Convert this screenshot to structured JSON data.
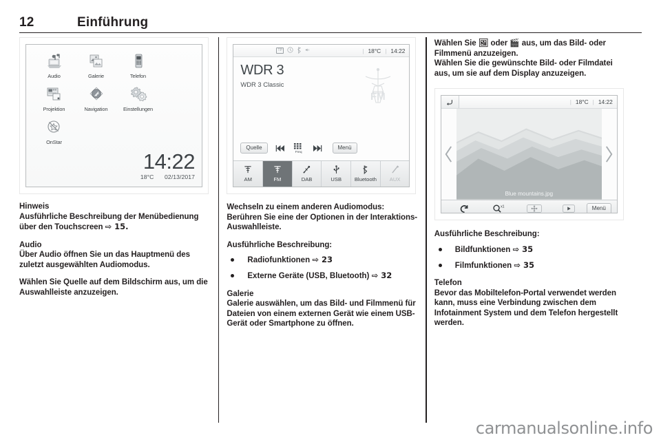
{
  "header": {
    "page_number": "12",
    "chapter": "Einführung"
  },
  "watermark": "carmanualsonline.info",
  "colors": {
    "text": "#231f20",
    "screen_border": "#b9bcbe",
    "active_tab": "#6f7477",
    "disabled_text": "#b4b8bb"
  },
  "screen_home": {
    "tiles": [
      {
        "label": "Audio",
        "icon": "audio-speaker-icon"
      },
      {
        "label": "Galerie",
        "icon": "gallery-pictures-icon"
      },
      {
        "label": "Telefon",
        "icon": "smartphone-icon"
      },
      {
        "label": "Projektion",
        "icon": "projection-screen-icon"
      },
      {
        "label": "Navigation",
        "icon": "navigation-compass-icon"
      },
      {
        "label": "Einstellungen",
        "icon": "settings-gears-icon"
      },
      {
        "label": "OnStar",
        "icon": "onstar-crossed-icon"
      }
    ],
    "clock": "14:22",
    "temperature": "18°C",
    "date": "02/13/2017"
  },
  "screen_radio": {
    "status_icons": [
      "tp-badge",
      "clock-icon",
      "bluetooth-icon",
      "mute-speaker-icon"
    ],
    "tp_label": "TP",
    "temperature": "18°C",
    "clock": "14:22",
    "station_name": "WDR 3",
    "station_info": "WDR 3 Classic",
    "logo_label": "FM",
    "controls": [
      {
        "label": "Quelle",
        "type": "pill",
        "icon": ""
      },
      {
        "label": "",
        "type": "icon",
        "icon": "skip-previous-icon"
      },
      {
        "label": "Freq",
        "type": "icon",
        "icon": "frequency-keypad-icon"
      },
      {
        "label": "",
        "type": "icon",
        "icon": "skip-next-icon"
      },
      {
        "label": "Menü",
        "type": "pill",
        "icon": ""
      }
    ],
    "sources": [
      {
        "label": "AM",
        "icon": "antenna-icon",
        "state": "normal"
      },
      {
        "label": "FM",
        "icon": "antenna-icon",
        "state": "active"
      },
      {
        "label": "DAB",
        "icon": "dab-antenna-icon",
        "state": "normal"
      },
      {
        "label": "USB",
        "icon": "usb-icon",
        "state": "normal"
      },
      {
        "label": "Bluetooth",
        "icon": "bluetooth-icon",
        "state": "normal"
      },
      {
        "label": "AUX",
        "icon": "aux-jack-icon",
        "state": "disabled"
      }
    ]
  },
  "screen_gallery": {
    "back_icon": "back-arrow-icon",
    "temperature": "18°C",
    "clock": "14:22",
    "file_name": "Blue mountains.jpg",
    "prev_icon": "chevron-left-icon",
    "next_icon": "chevron-right-icon",
    "tools": [
      {
        "icon": "rotate-icon",
        "label": ""
      },
      {
        "icon": "zoom-icon",
        "label": "x1"
      },
      {
        "icon": "pan-move-icon",
        "label": ""
      },
      {
        "icon": "slideshow-play-icon",
        "label": ""
      },
      {
        "icon": "",
        "label": "Menü"
      }
    ]
  },
  "col1": {
    "note_heading": "Hinweis",
    "note_text": "Ausführliche Beschreibung der Menübedienung über den Touchscreen ",
    "note_ref": "⇨ 15.",
    "audio_heading": "Audio",
    "audio_p1": "Über Audio öffnen Sie un das Hauptmenü des zuletzt ausgewählten Audiomodus.",
    "audio_p2": "Wählen Sie Quelle auf dem Bildschirm aus, um die Auswahlleiste anzuzeigen."
  },
  "col2": {
    "p1": "Wechseln zu einem anderen Audiomodus: Berühren Sie eine der Optionen in der Interaktions-Auswahlleiste.",
    "detail_heading": "Ausführliche Beschreibung:",
    "bullets": [
      {
        "text": "Radiofunktionen ",
        "ref": "⇨ 23"
      },
      {
        "text": "Externe Geräte (USB, Bluetooth) ",
        "ref": "⇨ 32"
      }
    ],
    "gallery_heading": "Galerie",
    "gallery_p": "Galerie auswählen, um das Bild- und Filmmenü für Dateien von einem externen Gerät wie einem USB-Gerät oder Smartphone zu öffnen."
  },
  "col3": {
    "p1": "Wählen Sie 🖼 oder 🎬 aus, um das Bild- oder Filmmenü anzuzeigen.",
    "p2": "Wählen Sie die gewünschte Bild- oder Filmdatei aus, um sie auf dem Display anzuzeigen.",
    "detail_heading": "Ausführliche Beschreibung:",
    "bullets": [
      {
        "text": "Bildfunktionen ",
        "ref": "⇨ 35"
      },
      {
        "text": "Filmfunktionen ",
        "ref": "⇨ 35"
      }
    ],
    "phone_heading": "Telefon",
    "phone_p": "Bevor das Mobiltelefon-Portal verwendet werden kann, muss eine Verbindung zwischen dem Infotainment System und dem Telefon hergestellt werden."
  }
}
